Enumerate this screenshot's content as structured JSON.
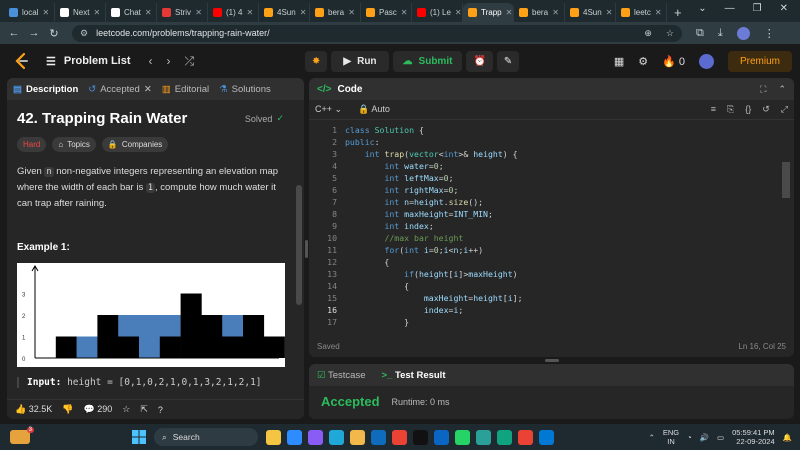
{
  "browser": {
    "tabs": [
      {
        "label": "local",
        "color": "#4a90d9"
      },
      {
        "label": "Next",
        "color": "#ffffff"
      },
      {
        "label": "Chat",
        "color": "#ffffff"
      },
      {
        "label": "Striv",
        "color": "#e53935"
      },
      {
        "label": "(1) 4",
        "color": "#ff0000"
      },
      {
        "label": "4Sun",
        "color": "#ffa116"
      },
      {
        "label": "bera",
        "color": "#ffa116"
      },
      {
        "label": "Pasc",
        "color": "#ffa116"
      },
      {
        "label": "(1) Le",
        "color": "#ff0000"
      },
      {
        "label": "Trapp",
        "color": "#ffa116",
        "active": true
      },
      {
        "label": "bera",
        "color": "#ffa116"
      },
      {
        "label": "4Sun",
        "color": "#ffa116"
      },
      {
        "label": "leetc",
        "color": "#ffa116"
      }
    ],
    "new_tab": "+",
    "url": "leetcode.com/problems/trapping-rain-water/"
  },
  "lcnav": {
    "problem_list": "Problem List",
    "run": "Run",
    "submit": "Submit",
    "streak": "0",
    "premium": "Premium"
  },
  "left": {
    "tabs": {
      "description": "Description",
      "accepted": "Accepted",
      "editorial": "Editorial",
      "solutions": "Solutions"
    },
    "title": "42. Trapping Rain Water",
    "solved": "Solved",
    "chips": {
      "difficulty": "Hard",
      "topics": "Topics",
      "companies": "Companies"
    },
    "desc": {
      "p1": "Given ",
      "n": "n",
      "p2": " non-negative integers representing an elevation map where the width of each bar is ",
      "one": "1",
      "p3": ", compute how much water it can trap after raining."
    },
    "example_title": "Example 1:",
    "figure": {
      "heights": [
        0,
        1,
        0,
        2,
        1,
        0,
        1,
        3,
        2,
        1,
        2,
        1
      ],
      "water": [
        0,
        0,
        1,
        0,
        1,
        2,
        1,
        0,
        0,
        1,
        0,
        0
      ],
      "y_ticks": [
        "3",
        "2",
        "1",
        "0"
      ],
      "bar_color": "#000000",
      "water_color": "#4a7ebb"
    },
    "input_label": "Input:",
    "input_value": "height = [0,1,0,2,1,0,1,3,2,1,2,1]",
    "likes": "32.5K",
    "comments": "290"
  },
  "code": {
    "title": "Code",
    "language": "C++",
    "auto": "Auto",
    "saved": "Saved",
    "cursor": "Ln 16, Col 25",
    "current_line": 16
  },
  "test": {
    "testcase": "Testcase",
    "result": "Test Result",
    "status": "Accepted",
    "runtime": "Runtime: 0 ms"
  },
  "taskbar": {
    "badge": "3",
    "search": "Search",
    "lang1": "ENG",
    "lang2": "IN",
    "time": "05:59:41 PM",
    "date": "22-09-2024"
  }
}
